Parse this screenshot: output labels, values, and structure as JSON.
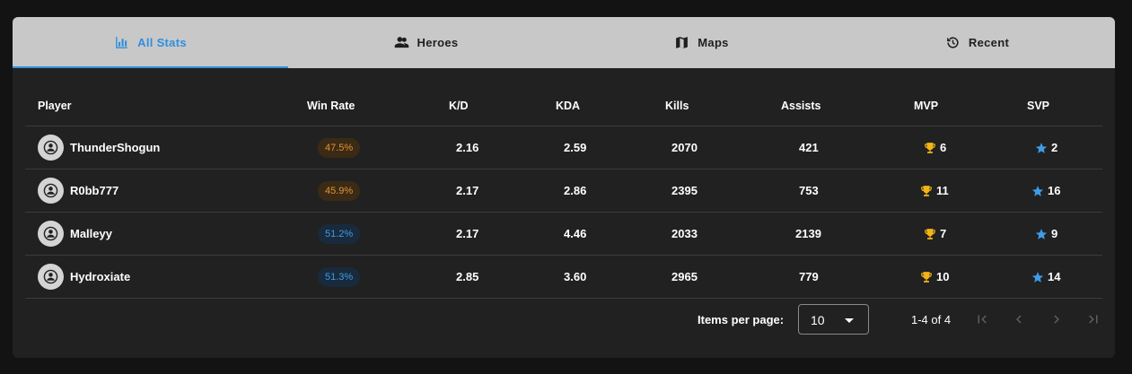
{
  "tabs": [
    {
      "label": "All Stats",
      "icon": "bar-chart-icon",
      "active": true
    },
    {
      "label": "Heroes",
      "icon": "people-icon",
      "active": false
    },
    {
      "label": "Maps",
      "icon": "map-icon",
      "active": false
    },
    {
      "label": "Recent",
      "icon": "history-icon",
      "active": false
    }
  ],
  "table": {
    "headers": [
      "Player",
      "Win Rate",
      "K/D",
      "KDA",
      "Kills",
      "Assists",
      "MVP",
      "SVP"
    ],
    "rows": [
      {
        "player": "ThunderShogun",
        "win_rate": "47.5%",
        "kd": "2.16",
        "kda": "2.59",
        "kills": "2070",
        "assists": "421",
        "mvp": "6",
        "svp": "2"
      },
      {
        "player": "R0bb777",
        "win_rate": "45.9%",
        "kd": "2.17",
        "kda": "2.86",
        "kills": "2395",
        "assists": "753",
        "mvp": "11",
        "svp": "16"
      },
      {
        "player": "Malleyy",
        "win_rate": "51.2%",
        "kd": "2.17",
        "kda": "4.46",
        "kills": "2033",
        "assists": "2139",
        "mvp": "7",
        "svp": "9"
      },
      {
        "player": "Hydroxiate",
        "win_rate": "51.3%",
        "kd": "2.85",
        "kda": "3.60",
        "kills": "2965",
        "assists": "779",
        "mvp": "10",
        "svp": "14"
      }
    ]
  },
  "pagination": {
    "items_per_page_label": "Items per page:",
    "items_per_page_value": "10",
    "range_label": "1-4 of 4"
  },
  "colors": {
    "accent": "#2f8fe0",
    "win_low": "#e0962e",
    "win_high": "#3f9be6",
    "trophy": "#f2b416",
    "star": "#3f9be6"
  }
}
